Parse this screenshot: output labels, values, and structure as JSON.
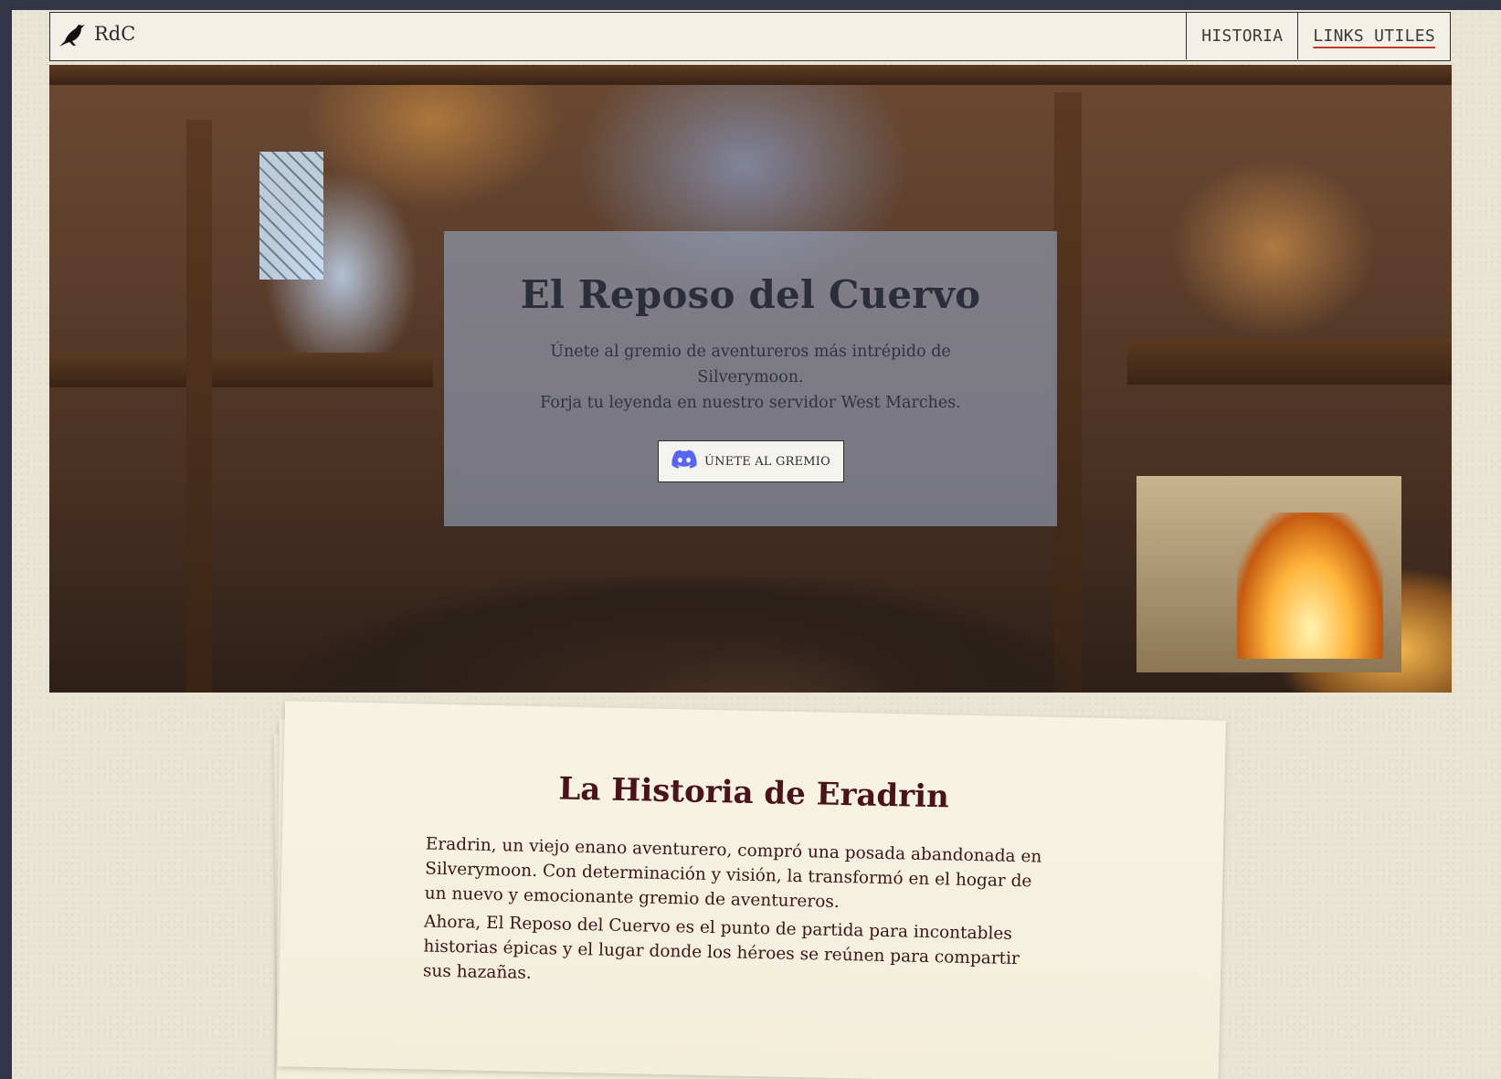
{
  "navbar": {
    "brand_icon": "raven-icon",
    "brand_text": "RdC",
    "links": [
      {
        "label": "HISTORIA",
        "active": false
      },
      {
        "label": "LINKS UTILES",
        "active": true
      }
    ]
  },
  "hero": {
    "title": "El Reposo del Cuervo",
    "subtitle_line1": "Únete al gremio de aventureros más intrépido de Silverymoon.",
    "subtitle_line2": "Forja tu leyenda en nuestro servidor West Marches.",
    "button_icon": "discord-icon",
    "button_label": "ÚNETE AL GREMIO"
  },
  "story": {
    "title": "La Historia de Eradrin",
    "paragraph1": "Eradrin, un viejo enano aventurero, compró una posada abandonada en Silverymoon. Con determinación y visión, la transformó en el hogar de un nuevo y emocionante gremio de aventureros.",
    "paragraph2": "Ahora, El Reposo del Cuervo es el punto de partida para incontables historias épicas y el lugar donde los héroes se reúnen para compartir sus hazañas."
  },
  "colors": {
    "page_background": "#e9e4d4",
    "outer_background": "#323646",
    "story_title": "#4a1219",
    "active_underline": "#c0392b",
    "discord": "#5865f2"
  }
}
